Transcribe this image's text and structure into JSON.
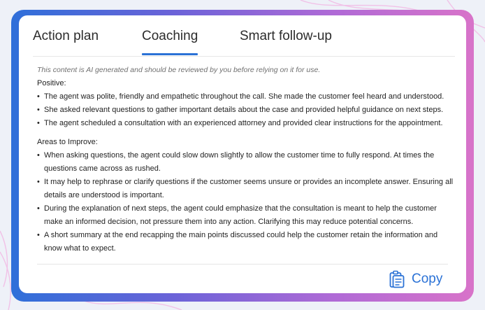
{
  "tabs": [
    {
      "label": "Action plan"
    },
    {
      "label": "Coaching"
    },
    {
      "label": "Smart follow-up"
    }
  ],
  "active_tab": "Coaching",
  "disclaimer": "This content is AI generated and should be reviewed by you before relying on it for use.",
  "positive": {
    "heading": "Positive:",
    "items": [
      "The agent was polite, friendly and empathetic throughout the call. She made the customer feel heard and understood.",
      "She asked relevant questions to gather important details about the case and provided helpful guidance on next steps.",
      "The agent scheduled a consultation with an experienced attorney and provided clear instructions for the appointment."
    ]
  },
  "improve": {
    "heading": "Areas to Improve:",
    "items": [
      "When asking questions, the agent could slow down slightly to allow the customer time to fully respond. At times the questions came across as rushed.",
      "It may help to rephrase or clarify questions if the customer seems unsure or provides an incomplete answer. Ensuring all details are understood is important.",
      "During the explanation of next steps, the agent could emphasize that the consultation is meant to help the customer make an informed decision, not pressure them into any action. Clarifying this may reduce potential concerns.",
      "A short summary at the end recapping the main points discussed could help the customer retain the information and know what to expect."
    ]
  },
  "copy_button": {
    "label": "Copy",
    "icon": "clipboard-icon"
  },
  "colors": {
    "accent": "#2b72d6",
    "frame_gradient": [
      "#2f6fd9",
      "#6b63d8",
      "#b06ad6",
      "#d873c9"
    ]
  }
}
